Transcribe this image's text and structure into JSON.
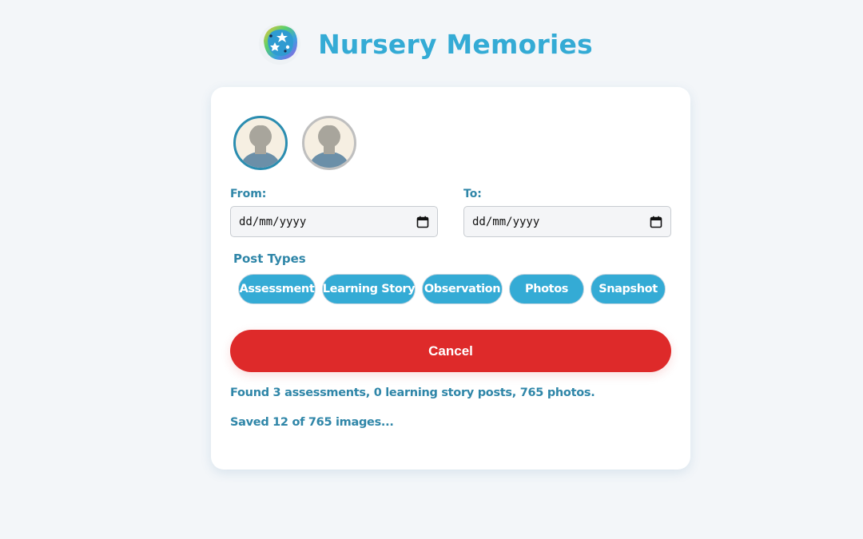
{
  "app": {
    "title": "Nursery Memories",
    "logo_icon": "stars-badge-icon"
  },
  "children": [
    {
      "avatar_icon": "child-silhouette-icon",
      "selected": true
    },
    {
      "avatar_icon": "child-silhouette-icon",
      "selected": false
    }
  ],
  "date_range": {
    "from_label": "From:",
    "to_label": "To:",
    "from_value": "dd/mm/yyyy",
    "to_value": "dd/mm/yyyy",
    "calendar_icon": "calendar-icon"
  },
  "post_types": {
    "label": "Post Types",
    "items": [
      "Assessment",
      "Learning Story",
      "Observation",
      "Photos",
      "Snapshot"
    ]
  },
  "actions": {
    "cancel_label": "Cancel"
  },
  "status": {
    "found": "Found 3 assessments, 0 learning story posts, 765 photos.",
    "progress": "Saved 12 of 765 images..."
  },
  "colors": {
    "accent": "#34abd5",
    "label": "#2f86a8",
    "danger": "#de2a2a",
    "background": "#f3f6f9"
  }
}
